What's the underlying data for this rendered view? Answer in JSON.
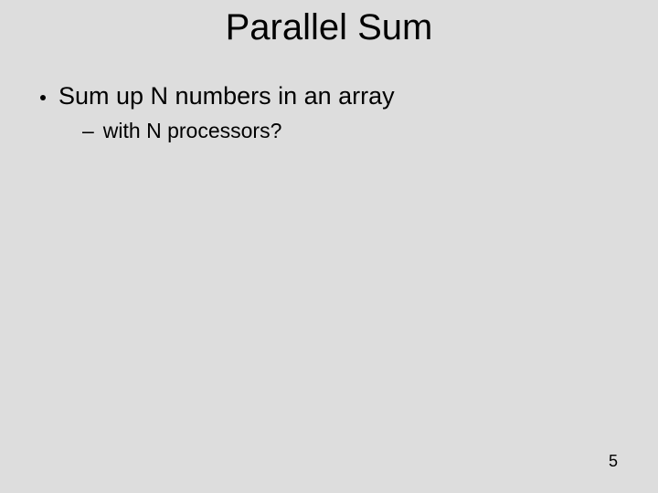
{
  "slide": {
    "title": "Parallel Sum",
    "bullets": {
      "level1": "Sum up N numbers in an array",
      "level2": "with N processors?"
    },
    "page_number": "5"
  }
}
